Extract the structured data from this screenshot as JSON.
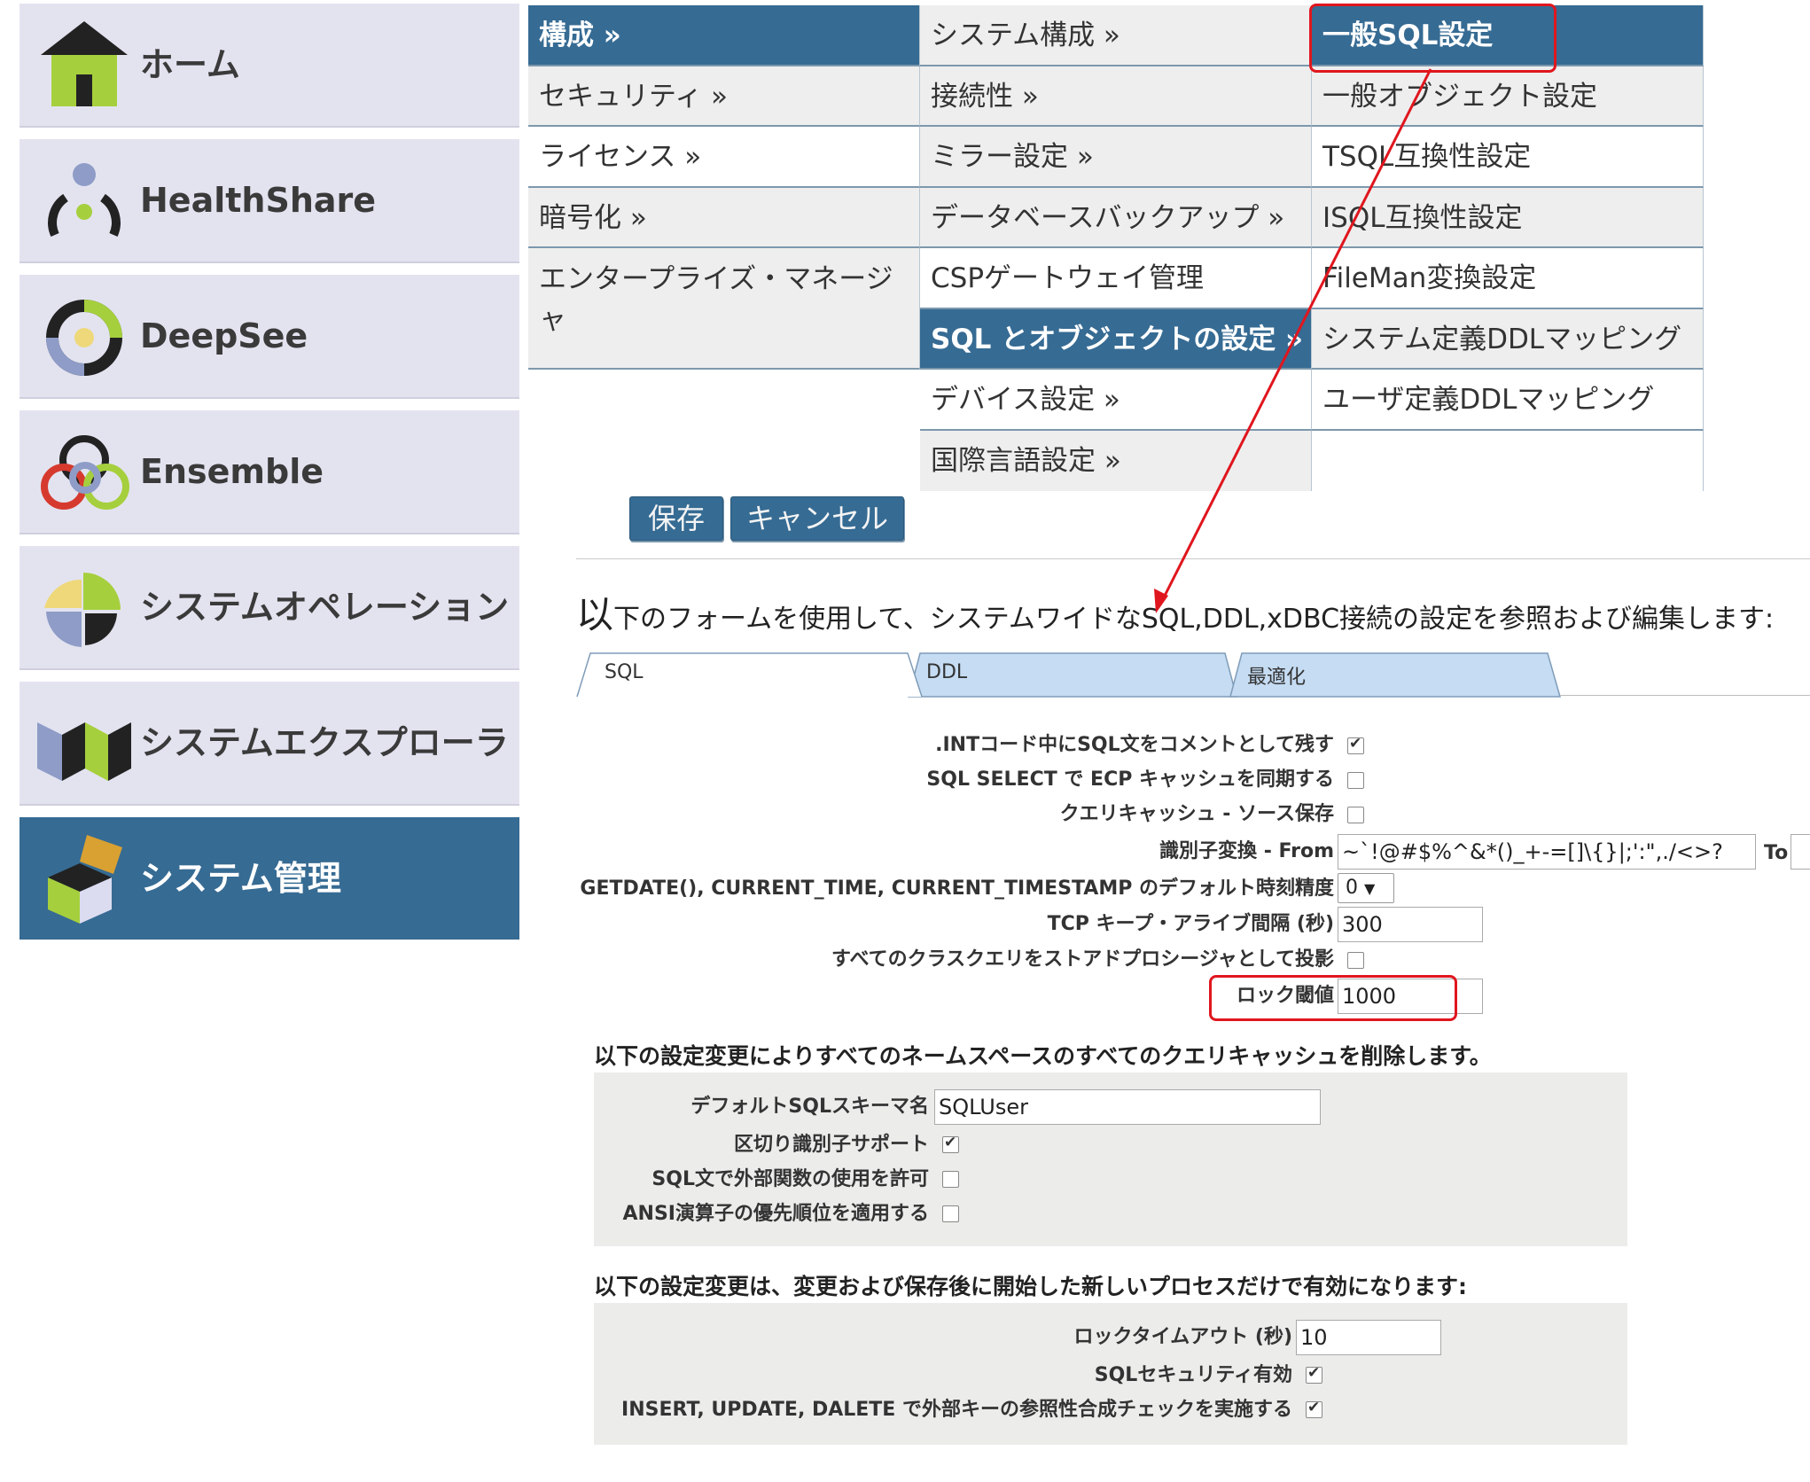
{
  "launcher": [
    {
      "label": "ホーム",
      "icon": "home-icon",
      "active": false
    },
    {
      "label": "HealthShare",
      "icon": "healthshare-icon",
      "active": false
    },
    {
      "label": "DeepSee",
      "icon": "deepsee-icon",
      "active": false
    },
    {
      "label": "Ensemble",
      "icon": "ensemble-icon",
      "active": false
    },
    {
      "label": "システムオペレーション",
      "icon": "system-operation-icon",
      "active": false
    },
    {
      "label": "システムエクスプローラ",
      "icon": "system-explorer-icon",
      "active": false
    },
    {
      "label": "システム管理",
      "icon": "system-admin-icon",
      "active": true
    }
  ],
  "menu": {
    "col1": [
      "構成 »",
      "セキュリティ »",
      "ライセンス »",
      "暗号化 »",
      "エンタープライズ・マネージャ"
    ],
    "col2": [
      "システム構成 »",
      "接続性 »",
      "ミラー設定 »",
      "データベースバックアップ »",
      "CSPゲートウェイ管理",
      "SQL とオブジェクトの設定 »",
      "デバイス設定 »",
      "国際言語設定 »"
    ],
    "col3": [
      "一般SQL設定",
      "一般オブジェクト設定",
      "TSQL互換性設定",
      "ISQL互換性設定",
      "FileMan変換設定",
      "システム定義DDLマッピング",
      "ユーザ定義DDLマッピング"
    ]
  },
  "buttons": {
    "save": "保存",
    "cancel": "キャンセル"
  },
  "description_first": "以",
  "description_rest": "下のフォームを使用して、システムワイドなSQL,DDL,xDBC接続の設定を参照および編集します:",
  "tabs": [
    "SQL",
    "DDL",
    "最適化"
  ],
  "sql_form": {
    "int_comment_label": ".INTコード中にSQL文をコメントとして残す",
    "int_comment": true,
    "ecp_sync_label": "SQL SELECT で ECP キャッシュを同期する",
    "ecp_sync": false,
    "cache_source_label": "クエリキャッシュ - ソース保存",
    "cache_source": false,
    "ident_from_label": "識別子変換 - From",
    "ident_from_value": "~`!@#$%^&*()_+-=[]\\{}|;':\",./<>?",
    "ident_to_label": "To",
    "precision_label": "GETDATE(), CURRENT_TIME, CURRENT_TIMESTAMP のデフォルト時刻精度",
    "precision_value": "0",
    "tcp_label": "TCP キープ・アライブ間隔 (秒)",
    "tcp_value": "300",
    "project_label": "すべてのクラスクエリをストアドプロシージャとして投影",
    "project": false,
    "lock_label": "ロック閾値",
    "lock_value": "1000"
  },
  "purge_section": {
    "heading": "以下の設定変更によりすべてのネームスペースのすべてのクエリキャッシュを削除します。",
    "schema_label": "デフォルトSQLスキーマ名",
    "schema_value": "SQLUser",
    "delim_label": "区切り識別子サポート",
    "delim": true,
    "external_label": "SQL文で外部関数の使用を許可",
    "external": false,
    "ansi_label": "ANSI演算子の優先順位を適用する",
    "ansi": false
  },
  "process_section": {
    "heading": "以下の設定変更は、変更および保存後に開始した新しいプロセスだけで有効になります:",
    "timeout_label": "ロックタイムアウト (秒)",
    "timeout_value": "10",
    "security_label": "SQLセキュリティ有効",
    "security": true,
    "fk_label": "INSERT, UPDATE, DALETE で外部キーの参照性合成チェックを実施する",
    "fk": true
  },
  "colors": {
    "accent": "#366b93",
    "tile": "#e3e3f0",
    "annotation": "#e0161e",
    "tab": "#c5dcf3"
  }
}
